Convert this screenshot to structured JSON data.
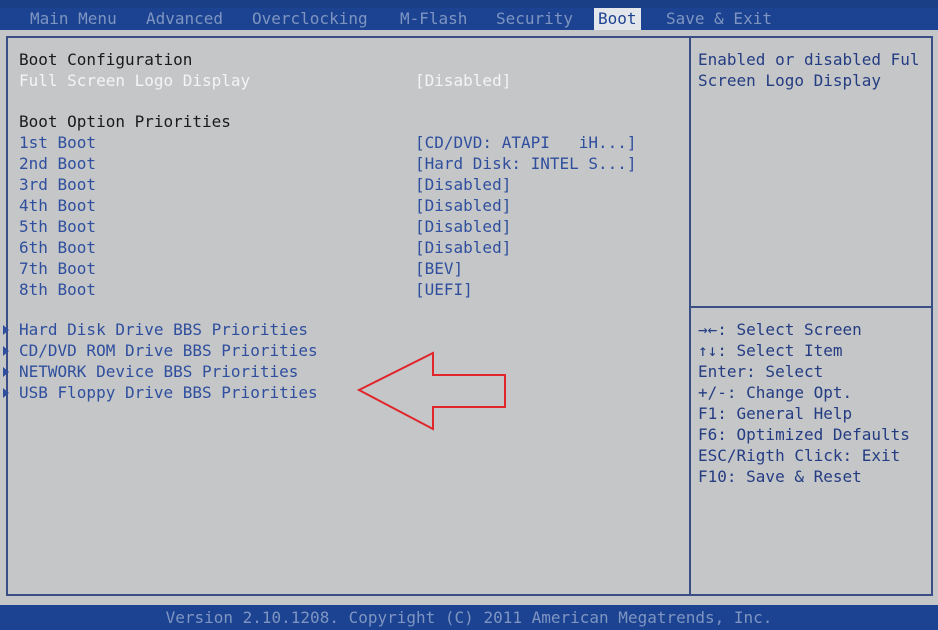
{
  "menu": {
    "tabs": [
      {
        "label": "Main Menu"
      },
      {
        "label": "Advanced"
      },
      {
        "label": "Overclocking"
      },
      {
        "label": "M-Flash"
      },
      {
        "label": "Security"
      },
      {
        "label": "Boot"
      },
      {
        "label": "Save & Exit"
      }
    ],
    "active_tab": "Boot"
  },
  "boot_config": {
    "heading": "Boot Configuration",
    "logo_label": "Full Screen Logo Display",
    "logo_value": "[Disabled]"
  },
  "priorities": {
    "heading": "Boot Option Priorities",
    "items": [
      {
        "label": "1st Boot",
        "value": "[CD/DVD: ATAPI   iH...]"
      },
      {
        "label": "2nd Boot",
        "value": "[Hard Disk: INTEL S...]"
      },
      {
        "label": "3rd Boot",
        "value": "[Disabled]"
      },
      {
        "label": "4th Boot",
        "value": "[Disabled]"
      },
      {
        "label": "5th Boot",
        "value": "[Disabled]"
      },
      {
        "label": "6th Boot",
        "value": "[Disabled]"
      },
      {
        "label": "7th Boot",
        "value": "[BEV]"
      },
      {
        "label": "8th Boot",
        "value": "[UEFI]"
      }
    ]
  },
  "submenus": [
    {
      "label": "Hard Disk Drive BBS Priorities"
    },
    {
      "label": "CD/DVD ROM Drive BBS Priorities"
    },
    {
      "label": "NETWORK Device BBS Priorities"
    },
    {
      "label": "USB Floppy Drive BBS Priorities"
    }
  ],
  "help": {
    "lines": [
      "Enabled or disabled Ful",
      "Screen Logo Display"
    ]
  },
  "keys": {
    "lines": [
      "→←: Select Screen",
      "↑↓: Select Item",
      "Enter: Select",
      "+/-: Change Opt.",
      "F1: General Help",
      "F6: Optimized Defaults",
      "ESC/Rigth Click: Exit",
      "F10: Save & Reset"
    ]
  },
  "footer": {
    "text": "Version 2.10.1208. Copyright (C) 2011 American Megatrends, Inc."
  },
  "colors": {
    "bar_blue": "#1c4391",
    "panel_gray": "#c4c6c8",
    "option_blue": "#2f4f9e",
    "arrow_red": "#e0262a"
  }
}
